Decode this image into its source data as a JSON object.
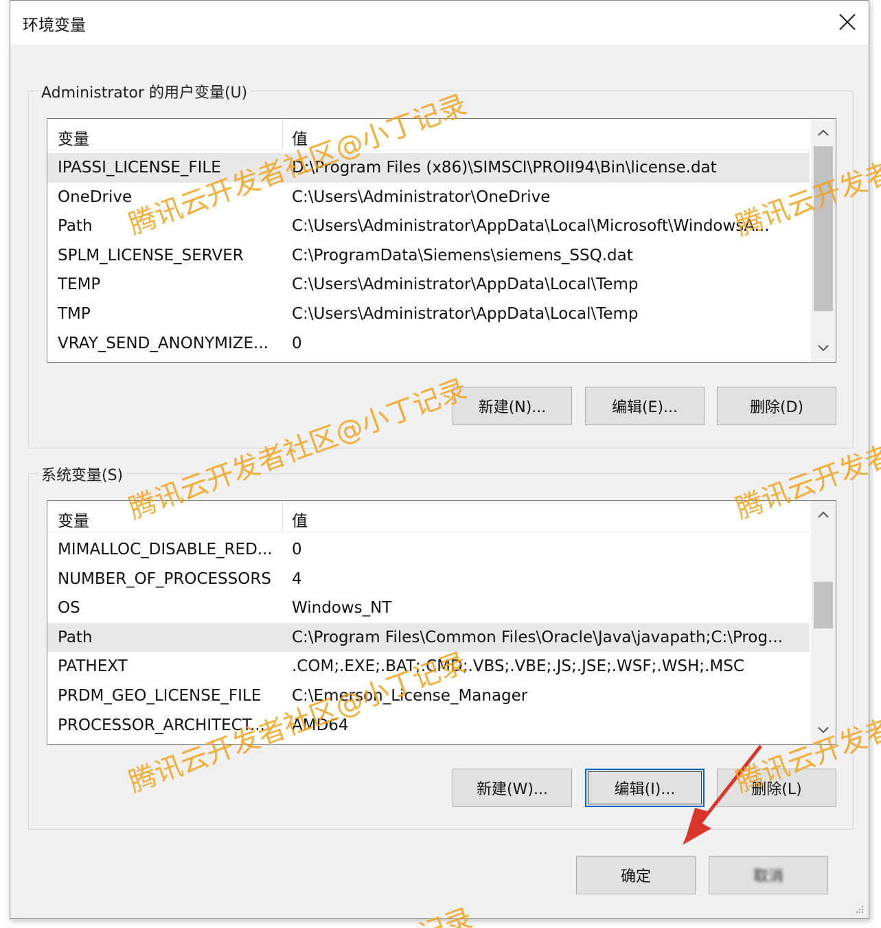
{
  "dialog": {
    "title": "环境变量",
    "close_icon": "close-icon"
  },
  "user_vars": {
    "legend": "Administrator 的用户变量(U)",
    "col_name": "变量",
    "col_value": "值",
    "rows": [
      {
        "name": "IPASSI_LICENSE_FILE",
        "value": "D:\\Program Files (x86)\\SIMSCI\\PROII94\\Bin\\license.dat"
      },
      {
        "name": "OneDrive",
        "value": "C:\\Users\\Administrator\\OneDrive"
      },
      {
        "name": "Path",
        "value": "C:\\Users\\Administrator\\AppData\\Local\\Microsoft\\WindowsA..."
      },
      {
        "name": "SPLM_LICENSE_SERVER",
        "value": "C:\\ProgramData\\Siemens\\siemens_SSQ.dat"
      },
      {
        "name": "TEMP",
        "value": "C:\\Users\\Administrator\\AppData\\Local\\Temp"
      },
      {
        "name": "TMP",
        "value": "C:\\Users\\Administrator\\AppData\\Local\\Temp"
      },
      {
        "name": "VRAY_SEND_ANONYMIZE...",
        "value": "0"
      }
    ],
    "selected_index": 0,
    "new_label": "新建(N)...",
    "edit_label": "编辑(E)...",
    "delete_label": "删除(D)"
  },
  "system_vars": {
    "legend": "系统变量(S)",
    "col_name": "变量",
    "col_value": "值",
    "rows": [
      {
        "name": "MIMALLOC_DISABLE_RED...",
        "value": "0"
      },
      {
        "name": "NUMBER_OF_PROCESSORS",
        "value": "4"
      },
      {
        "name": "OS",
        "value": "Windows_NT"
      },
      {
        "name": "Path",
        "value": "C:\\Program Files\\Common Files\\Oracle\\Java\\javapath;C:\\Prog..."
      },
      {
        "name": "PATHEXT",
        "value": ".COM;.EXE;.BAT;.CMD;.VBS;.VBE;.JS;.JSE;.WSF;.WSH;.MSC"
      },
      {
        "name": "PRDM_GEO_LICENSE_FILE",
        "value": "C:\\Emerson_License_Manager"
      },
      {
        "name": "PROCESSOR_ARCHITECT...",
        "value": "AMD64"
      }
    ],
    "selected_index": 3,
    "new_label": "新建(W)...",
    "edit_label": "编辑(I)...",
    "delete_label": "删除(L)"
  },
  "footer": {
    "ok_label": "确定",
    "cancel_label": "取消"
  },
  "watermarks": [
    "腾讯云开发者社区@小丁记录",
    "腾讯云开发者",
    "腾讯云开发者社区@小丁记录",
    "腾讯云开发者",
    "腾讯云开发者社区@小丁记录",
    "腾讯云开发者",
    "记录"
  ],
  "colors": {
    "watermark": "#f2a21a",
    "arrow": "#d9362b",
    "focus": "#0a64c8"
  }
}
